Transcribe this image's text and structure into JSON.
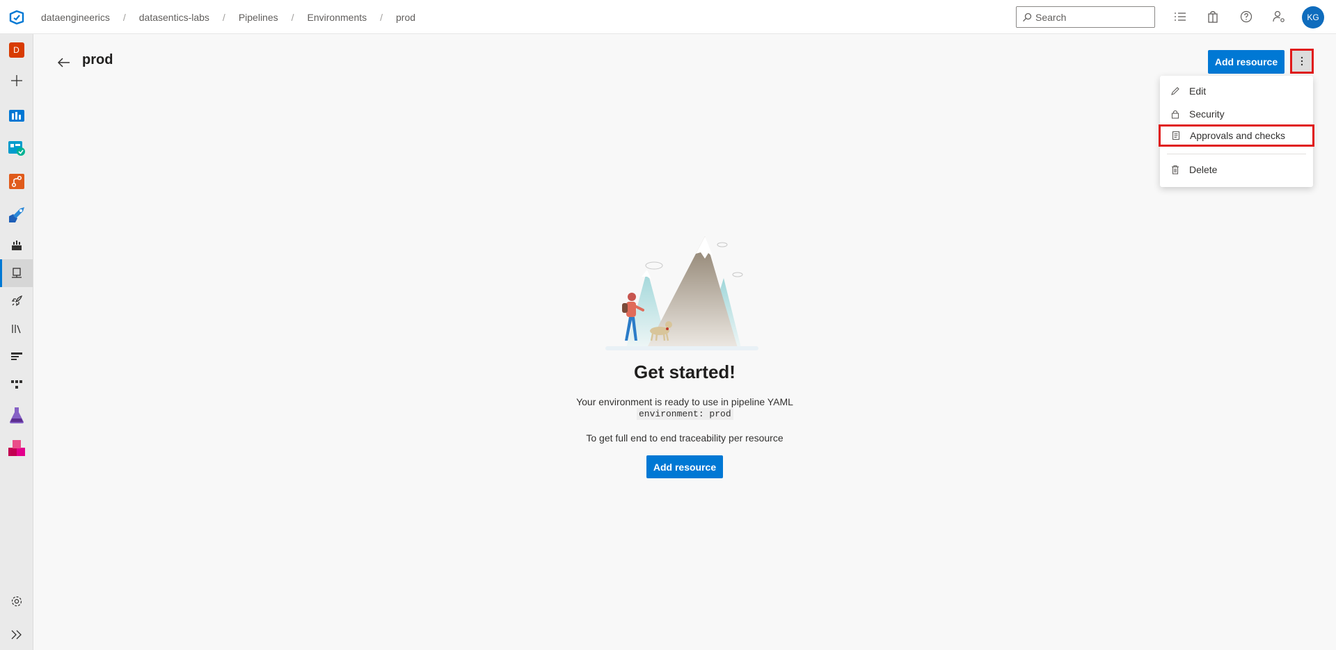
{
  "breadcrumbs": [
    "dataengineerics",
    "datasentics-labs",
    "Pipelines",
    "Environments",
    "prod"
  ],
  "search": {
    "placeholder": "Search"
  },
  "user": {
    "initials": "KG"
  },
  "rail": {
    "project_initial": "D"
  },
  "page": {
    "title": "prod",
    "add_resource_label": "Add resource"
  },
  "menu": {
    "items": [
      {
        "label": "Edit",
        "icon": "pencil-icon"
      },
      {
        "label": "Security",
        "icon": "lock-icon"
      },
      {
        "label": "Approvals and checks",
        "icon": "checklist-icon"
      },
      {
        "label": "Delete",
        "icon": "trash-icon"
      }
    ]
  },
  "empty_state": {
    "headline": "Get started!",
    "line1": "Your environment is ready to use in pipeline YAML",
    "code": "environment: prod",
    "line2": "To get full end to end traceability per resource",
    "button": "Add resource"
  },
  "colors": {
    "accent": "#0078d4",
    "highlight": "#e01919",
    "project_badge": "#d83b01"
  }
}
